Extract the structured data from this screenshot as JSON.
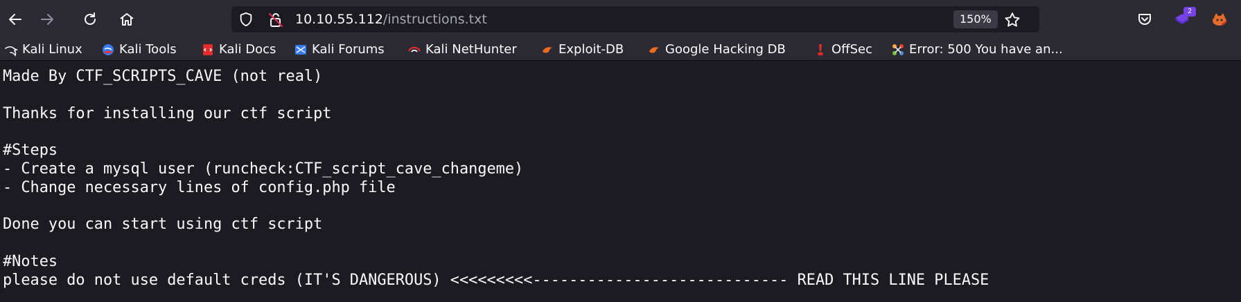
{
  "toolbar": {
    "back_icon": "back-arrow-icon",
    "forward_icon": "forward-arrow-icon",
    "reload_icon": "reload-icon",
    "home_icon": "home-icon",
    "url_host": "10.10.55.112",
    "url_path": "/instructions.txt",
    "zoom": "150%",
    "bookmark_star_icon": "star-icon",
    "pocket_icon": "pocket-icon",
    "extension_badge": "2",
    "extension_icon": "extension-icon",
    "account_icon": "foxyproxy-icon"
  },
  "bookmarks": [
    {
      "label": "Kali Linux",
      "icon": "kali-dragon-icon"
    },
    {
      "label": "Kali Tools",
      "icon": "kali-tools-icon"
    },
    {
      "label": "Kali Docs",
      "icon": "kali-docs-icon"
    },
    {
      "label": "Kali Forums",
      "icon": "kali-forums-icon"
    },
    {
      "label": "Kali NetHunter",
      "icon": "kali-nethunter-icon"
    },
    {
      "label": "Exploit-DB",
      "icon": "exploit-db-icon"
    },
    {
      "label": "Google Hacking DB",
      "icon": "ghdb-icon"
    },
    {
      "label": "OffSec",
      "icon": "offsec-icon"
    },
    {
      "label": "Error: 500 You have an...",
      "icon": "joomla-icon"
    }
  ],
  "document": {
    "lines": [
      "Made By CTF_SCRIPTS_CAVE (not real)",
      "",
      "Thanks for installing our ctf script",
      "",
      "#Steps",
      "- Create a mysql user (runcheck:CTF_script_cave_changeme)",
      "- Change necessary lines of config.php file",
      "",
      "Done you can start using ctf script",
      "",
      "#Notes",
      "please do not use default creds (IT'S DANGEROUS) <<<<<<<<<---------------------------- READ THIS LINE PLEASE"
    ]
  },
  "colors": {
    "toolbar_bg": "#2b2a33",
    "page_bg": "#1c1b22",
    "text": "#fbfbfe",
    "accent_purple": "#7542e5"
  }
}
